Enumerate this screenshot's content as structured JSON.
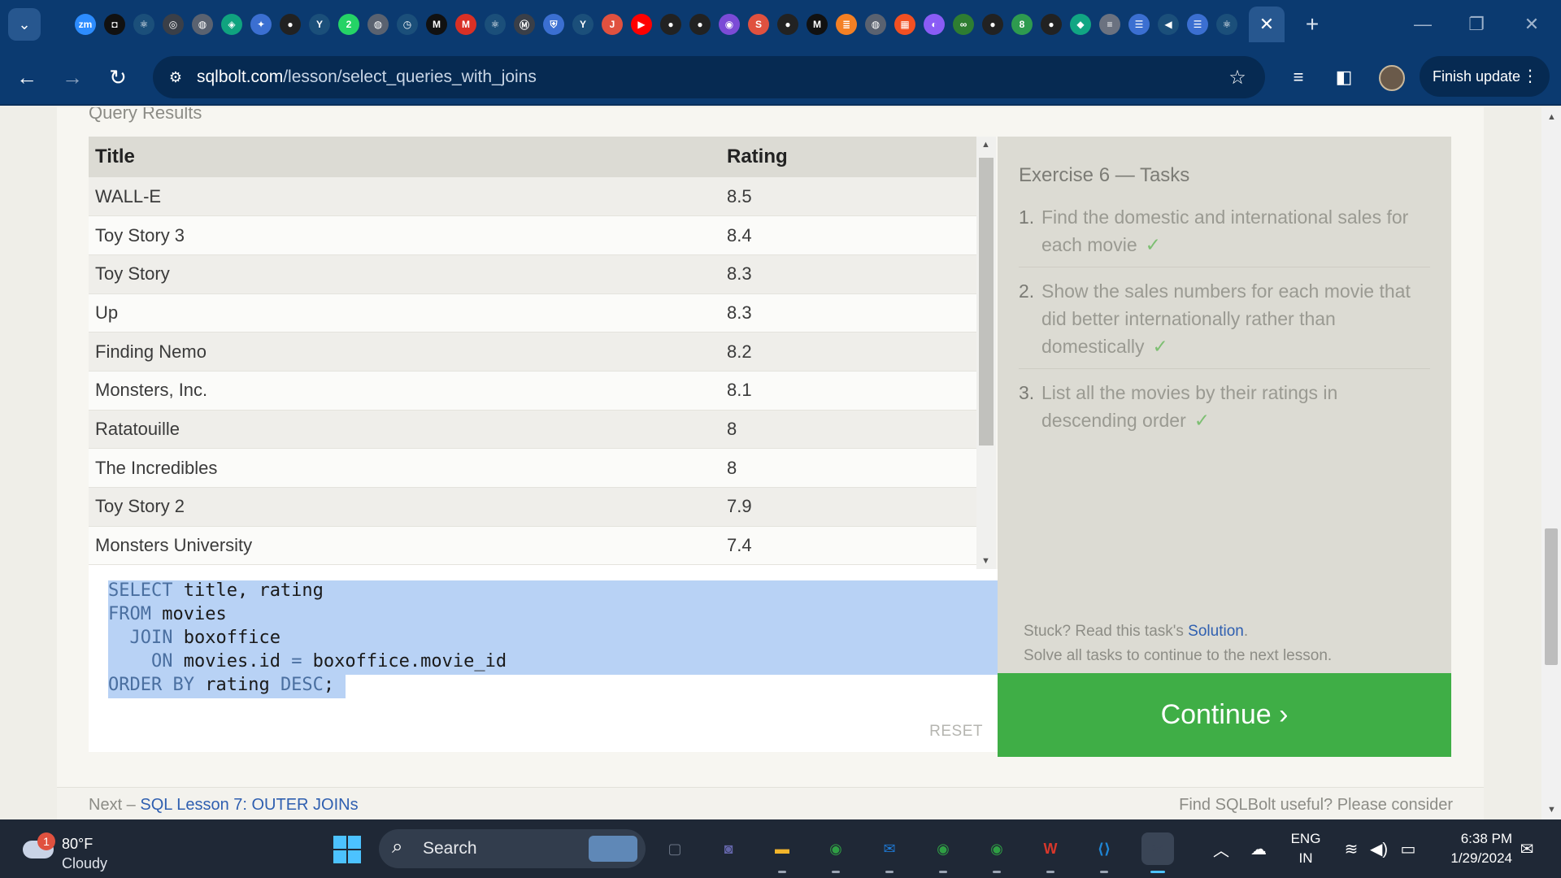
{
  "browser": {
    "tab_menu_icon": "chevron-down-icon",
    "active_tab_close": "✕",
    "new_tab": "+",
    "favicons": [
      {
        "name": "zoom-icon",
        "text": "zm",
        "color": "#2d8cff"
      },
      {
        "name": "notion-icon",
        "text": "◘",
        "color": "#111111"
      },
      {
        "name": "react-icon",
        "text": "⚛",
        "color": "#1b4f7a"
      },
      {
        "name": "openai-icon",
        "text": "◎",
        "color": "#3a3f48"
      },
      {
        "name": "globe-icon",
        "text": "◍",
        "color": "#5a6270"
      },
      {
        "name": "chatgpt-icon",
        "text": "◈",
        "color": "#10a37f"
      },
      {
        "name": "sparkle-icon",
        "text": "✦",
        "color": "#3b6fd1"
      },
      {
        "name": "github-icon",
        "text": "●",
        "color": "#222222"
      },
      {
        "name": "y-icon",
        "text": "Y",
        "color": "#1b4f7a"
      },
      {
        "name": "whatsapp-icon",
        "text": "2",
        "color": "#25d366"
      },
      {
        "name": "globe-icon",
        "text": "◍",
        "color": "#5a6270"
      },
      {
        "name": "clock-icon",
        "text": "◷",
        "color": "#1b4f7a"
      },
      {
        "name": "medium-icon",
        "text": "M",
        "color": "#111111"
      },
      {
        "name": "gmail-icon",
        "text": "M",
        "color": "#d93025"
      },
      {
        "name": "react-icon",
        "text": "⚛",
        "color": "#1b4f7a"
      },
      {
        "name": "m-circle-icon",
        "text": "Ⓜ",
        "color": "#3a3f48"
      },
      {
        "name": "shield-icon",
        "text": "⛨",
        "color": "#3b6fd1"
      },
      {
        "name": "y-icon",
        "text": "Y",
        "color": "#1b4f7a"
      },
      {
        "name": "j-icon",
        "text": "J",
        "color": "#e0513f"
      },
      {
        "name": "youtube-icon",
        "text": "▶",
        "color": "#ff0000"
      },
      {
        "name": "github-icon",
        "text": "●",
        "color": "#222222"
      },
      {
        "name": "github-icon",
        "text": "●",
        "color": "#222222"
      },
      {
        "name": "record-icon",
        "text": "◉",
        "color": "#7b4bd6"
      },
      {
        "name": "s-icon",
        "text": "S",
        "color": "#e0513f"
      },
      {
        "name": "github-icon",
        "text": "●",
        "color": "#222222"
      },
      {
        "name": "medium-icon",
        "text": "M",
        "color": "#111111"
      },
      {
        "name": "stackoverflow-icon",
        "text": "≣",
        "color": "#f48024"
      },
      {
        "name": "globe-icon",
        "text": "◍",
        "color": "#5a6270"
      },
      {
        "name": "microsoft-icon",
        "text": "▦",
        "color": "#f25022"
      },
      {
        "name": "copilot-icon",
        "text": "◐",
        "color": "#8a5cf5"
      },
      {
        "name": "link-icon",
        "text": "∞",
        "color": "#2e7d32"
      },
      {
        "name": "github-icon",
        "text": "●",
        "color": "#222222"
      },
      {
        "name": "eight-icon",
        "text": "8",
        "color": "#2e9b4f"
      },
      {
        "name": "github-icon",
        "text": "●",
        "color": "#222222"
      },
      {
        "name": "diamond-icon",
        "text": "◆",
        "color": "#11a683"
      },
      {
        "name": "database-icon",
        "text": "≡",
        "color": "#6b7280"
      },
      {
        "name": "docs-icon",
        "text": "☰",
        "color": "#3b6fd1"
      },
      {
        "name": "speaker-icon",
        "text": "◀",
        "color": "#1b4f7a"
      },
      {
        "name": "docs-icon",
        "text": "☰",
        "color": "#3b6fd1"
      },
      {
        "name": "react-icon",
        "text": "⚛",
        "color": "#1b4f7a"
      }
    ],
    "url_host": "sqlbolt.com",
    "url_path": "/lesson/select_queries_with_joins",
    "update_label": "Finish update"
  },
  "results": {
    "label": "Query Results",
    "columns": [
      "Title",
      "Rating"
    ],
    "rows": [
      [
        "WALL-E",
        "8.5"
      ],
      [
        "Toy Story 3",
        "8.4"
      ],
      [
        "Toy Story",
        "8.3"
      ],
      [
        "Up",
        "8.3"
      ],
      [
        "Finding Nemo",
        "8.2"
      ],
      [
        "Monsters, Inc.",
        "8.1"
      ],
      [
        "Ratatouille",
        "8"
      ],
      [
        "The Incredibles",
        "8"
      ],
      [
        "Toy Story 2",
        "7.9"
      ],
      [
        "Monsters University",
        "7.4"
      ]
    ]
  },
  "editor": {
    "lines": [
      [
        {
          "t": "SELECT",
          "k": true
        },
        {
          "t": " title, rating"
        }
      ],
      [
        {
          "t": "FROM",
          "k": true
        },
        {
          "t": " movies"
        }
      ],
      [
        {
          "t": "  "
        },
        {
          "t": "JOIN",
          "k": true
        },
        {
          "t": " boxoffice"
        }
      ],
      [
        {
          "t": "    "
        },
        {
          "t": "ON",
          "k": true
        },
        {
          "t": " movies.id "
        },
        {
          "t": "=",
          "k": true
        },
        {
          "t": " boxoffice.movie_id"
        }
      ],
      [
        {
          "t": "ORDER BY",
          "k": true
        },
        {
          "t": " rating "
        },
        {
          "t": "DESC",
          "k": true
        },
        {
          "t": ";"
        }
      ]
    ],
    "reset_label": "RESET"
  },
  "tasks": {
    "title": "Exercise 6 — Tasks",
    "items": [
      {
        "num": "1.",
        "text": "Find the domestic and international sales for each movie",
        "check": "✓"
      },
      {
        "num": "2.",
        "text": "Show the sales numbers for each movie that did better internationally rather than domestically",
        "check": "✓"
      },
      {
        "num": "3.",
        "text": "List all the movies by their ratings in descending order",
        "check": "✓"
      }
    ],
    "stuck_prefix": "Stuck? Read this task's ",
    "solution_link": "Solution",
    "stuck_suffix": ".",
    "solve_all": "Solve all tasks to continue to the next lesson."
  },
  "continue_label": "Continue ›",
  "footer": {
    "next_prefix": "Next – ",
    "next_link": "SQL Lesson 7: OUTER JOINs",
    "right_text": "Find SQLBolt useful? Please consider"
  },
  "taskbar": {
    "weather_badge": "1",
    "temperature": "80°F",
    "condition": "Cloudy",
    "search_label": "Search",
    "language_top": "ENG",
    "language_bottom": "IN",
    "time": "6:38 PM",
    "date": "1/29/2024",
    "apps": [
      {
        "name": "task-view-icon",
        "text": "▢",
        "color": "#6b7585"
      },
      {
        "name": "teams-icon",
        "text": "◙",
        "color": "#6264a7"
      },
      {
        "name": "file-explorer-icon",
        "text": "▬",
        "color": "#f2b52b"
      },
      {
        "name": "chrome-icon",
        "text": "◉",
        "color": "#2f9e44"
      },
      {
        "name": "mail-icon",
        "text": "✉",
        "color": "#1e78d2"
      },
      {
        "name": "chrome-profile-icon",
        "text": "◉",
        "color": "#2f9e44"
      },
      {
        "name": "chrome-profile-icon",
        "text": "◉",
        "color": "#2f9e44"
      },
      {
        "name": "wps-office-icon",
        "text": "W",
        "color": "#d8372b"
      },
      {
        "name": "vscode-icon",
        "text": "⟨⟩",
        "color": "#1f86d6"
      },
      {
        "name": "snipping-tool-icon",
        "text": "✂",
        "color": "#3a4556"
      }
    ]
  }
}
